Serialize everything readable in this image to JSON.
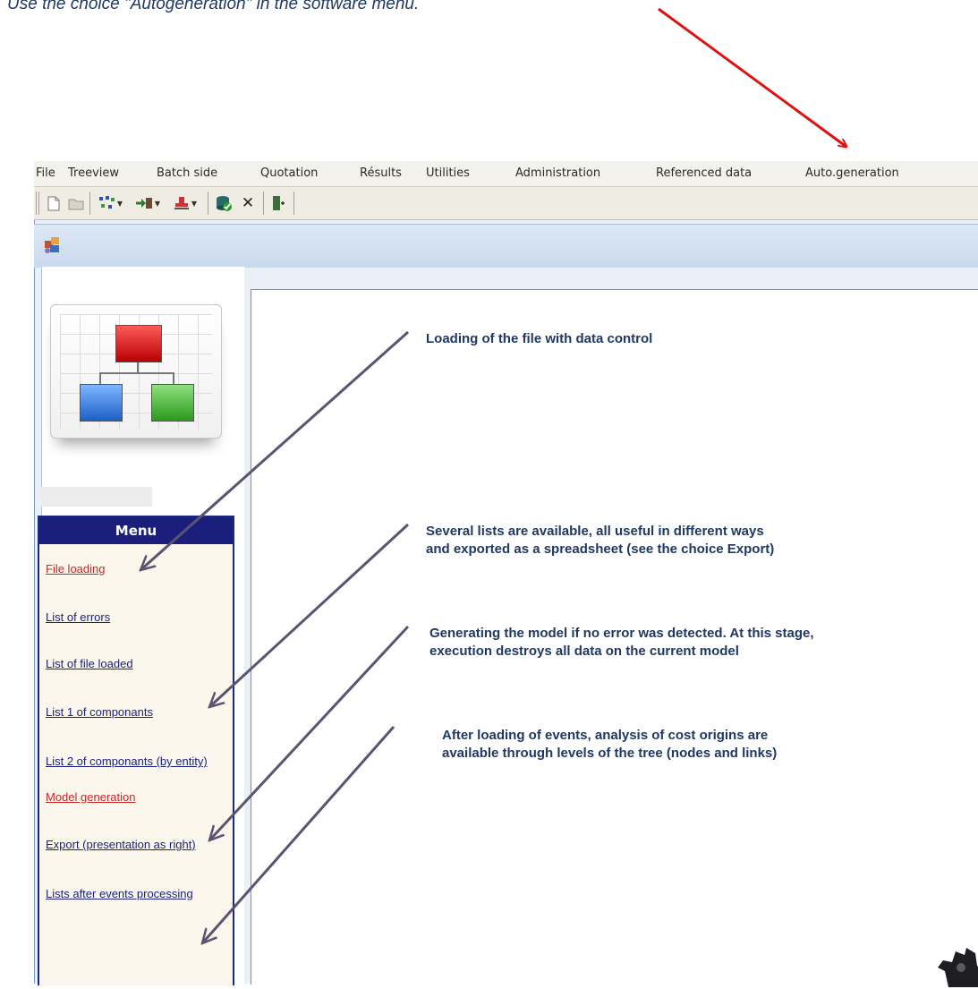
{
  "intro_text": "Use the choice \"Autogeneration\" in the software menu.",
  "menubar": {
    "items": [
      {
        "id": "file",
        "label": "File"
      },
      {
        "id": "treeview",
        "label": "Treeview"
      },
      {
        "id": "batch-side",
        "label": "Batch side"
      },
      {
        "id": "quotation",
        "label": "Quotation"
      },
      {
        "id": "results",
        "label": "Résults"
      },
      {
        "id": "utilities",
        "label": "Utilities"
      },
      {
        "id": "administration",
        "label": "Administration"
      },
      {
        "id": "referenced-data",
        "label": "Referenced data"
      },
      {
        "id": "auto-generation",
        "label": "Auto.generation"
      }
    ]
  },
  "toolbar": {
    "delete_glyph": "✕"
  },
  "menu": {
    "header": "Menu",
    "items": [
      {
        "label": "File loading",
        "active": true
      },
      {
        "label": "List of errors",
        "active": false
      },
      {
        "label": "List of file loaded",
        "active": false
      },
      {
        "label": "List 1 of componants",
        "active": false
      },
      {
        "label": "List 2 of componants (by entity)",
        "active": false
      },
      {
        "label": "Model generation",
        "active": true
      },
      {
        "label": "Export (presentation as right)",
        "active": false
      },
      {
        "label": "Lists after events processing",
        "active": false
      }
    ]
  },
  "annotations": {
    "loading": "Loading of the file with data control",
    "lists_line1": "Several lists are available, all useful in different ways",
    "lists_line2": "and exported as a spreadsheet (see the choice Export)",
    "generation_line1": "Generating the model if no error was detected. At this stage,",
    "generation_line2": "execution destroys all data on the current model",
    "events_line1": "After loading of events, analysis of cost origins are",
    "events_line2": "available through levels of the tree (nodes and links)"
  },
  "colors": {
    "menu_header_bg": "#1c1e7c",
    "menu_link": "#1a237e",
    "menu_link_active": "#c62828",
    "annotation_text": "#1f3864",
    "callout_arrow": "#e01010",
    "pointer_arrow": "#5a5470"
  }
}
